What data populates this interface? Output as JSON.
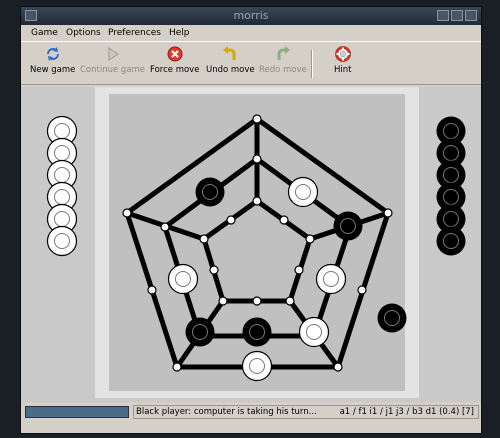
{
  "window": {
    "title": "morris"
  },
  "menu": [
    "Game",
    "Options",
    "Preferences",
    "Help"
  ],
  "toolbar": [
    {
      "label": "New game",
      "icon": "refresh-icon",
      "enabled": true
    },
    {
      "label": "Continue game",
      "icon": "play-icon",
      "enabled": false
    },
    {
      "label": "Force move",
      "icon": "stop-icon",
      "enabled": true
    },
    {
      "label": "Undo move",
      "icon": "undo-arrow-icon",
      "enabled": true
    },
    {
      "label": "Redo move",
      "icon": "redo-arrow-icon",
      "enabled": false
    },
    {
      "label": "Hint",
      "icon": "lifebuoy-icon",
      "enabled": true
    }
  ],
  "board": {
    "white_reserve": 6,
    "black_reserve": 6,
    "colors": {
      "board_bg": "#c0c0c0",
      "frame": "#e3e3e3",
      "side_panel": "#c9c9c9"
    }
  },
  "status": {
    "message": "Black player: computer is taking his turn...",
    "move_info": "a1 / f1 i1 / j1 j3 / b3 d1 (0.4) [7]"
  }
}
